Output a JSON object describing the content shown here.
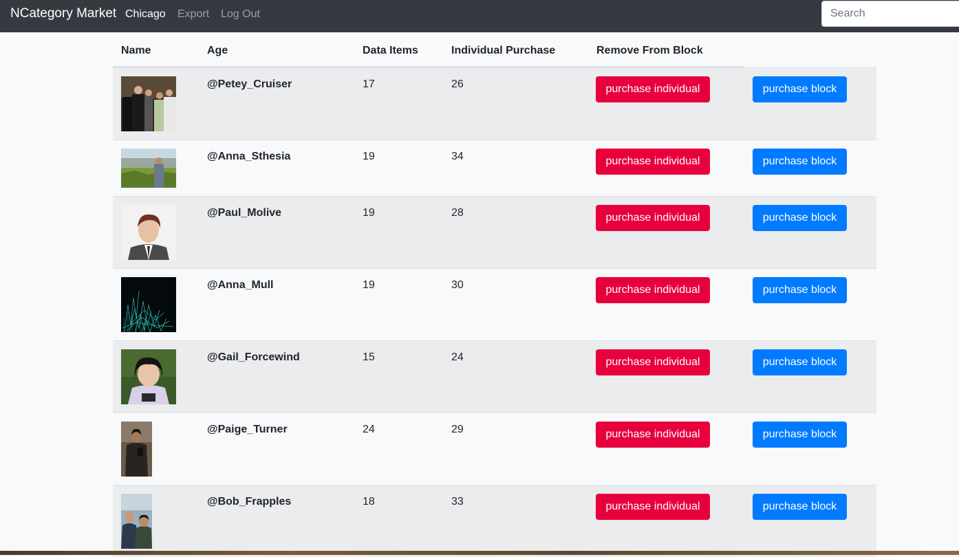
{
  "navbar": {
    "brand": "NCategory Market",
    "links": [
      {
        "label": "Chicago",
        "active": true
      },
      {
        "label": "Export",
        "active": false
      },
      {
        "label": "Log Out",
        "active": false
      }
    ],
    "search_placeholder": "Search"
  },
  "table": {
    "headers": [
      "Name",
      "Age",
      "Data Items",
      "Individual Purchase",
      "Remove From Block"
    ],
    "rows": [
      {
        "name": "@Petey_Cruiser",
        "age": "17",
        "data_items": "26",
        "individual_label": "purchase individual",
        "block_label": "purchase block"
      },
      {
        "name": "@Anna_Sthesia",
        "age": "19",
        "data_items": "34",
        "individual_label": "purchase individual",
        "block_label": "purchase block"
      },
      {
        "name": "@Paul_Molive",
        "age": "19",
        "data_items": "28",
        "individual_label": "purchase individual",
        "block_label": "purchase block"
      },
      {
        "name": "@Anna_Mull",
        "age": "19",
        "data_items": "30",
        "individual_label": "purchase individual",
        "block_label": "purchase block"
      },
      {
        "name": "@Gail_Forcewind",
        "age": "15",
        "data_items": "24",
        "individual_label": "purchase individual",
        "block_label": "purchase block"
      },
      {
        "name": "@Paige_Turner",
        "age": "24",
        "data_items": "29",
        "individual_label": "purchase individual",
        "block_label": "purchase block"
      },
      {
        "name": "@Bob_Frapples",
        "age": "18",
        "data_items": "33",
        "individual_label": "purchase individual",
        "block_label": "purchase block"
      }
    ]
  },
  "colors": {
    "navbar_bg": "#343a40",
    "purchase_individual": "#e8003d",
    "purchase_block": "#007bff",
    "row_striped": "#ebecee"
  }
}
